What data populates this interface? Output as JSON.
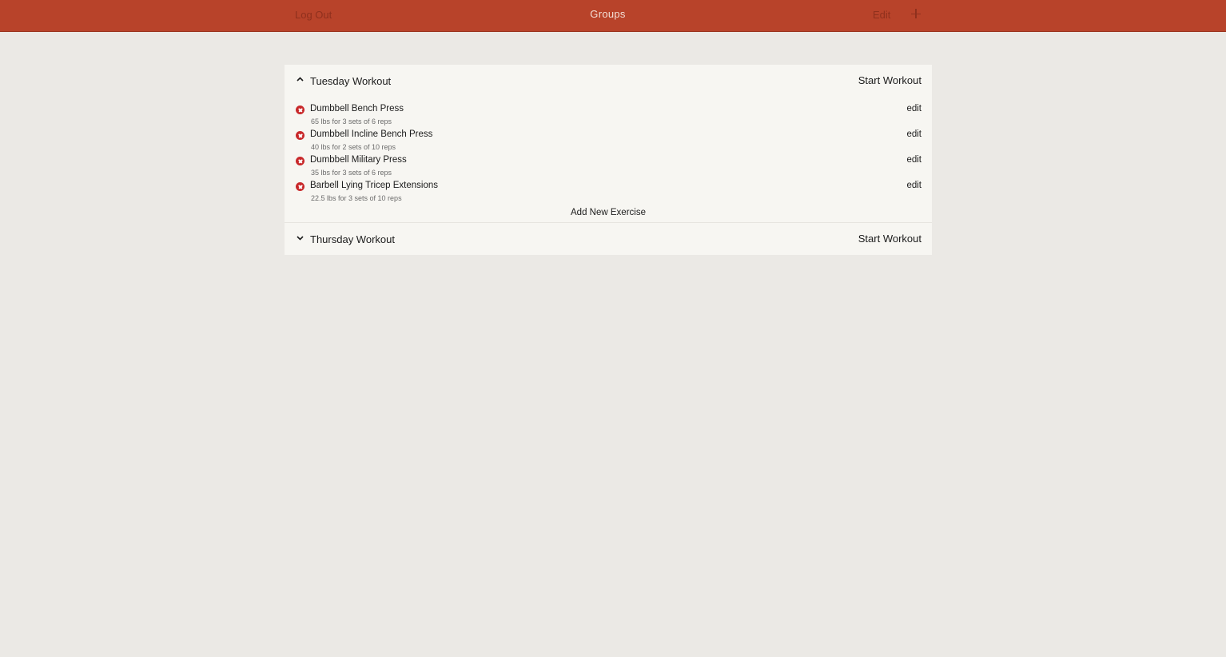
{
  "header": {
    "logout_label": "Log Out",
    "title": "Groups",
    "edit_label": "Edit",
    "add_icon": "plus-icon"
  },
  "groups": [
    {
      "name": "Tuesday Workout",
      "expanded": true,
      "chevron_icon": "chevron-up-icon",
      "start_label": "Start Workout",
      "exercises": [
        {
          "name": "Dumbbell Bench Press",
          "detail": "65 lbs for 3 sets of 6 reps",
          "edit_label": "edit"
        },
        {
          "name": "Dumbbell Incline Bench Press",
          "detail": "40 lbs for 2 sets of 10 reps",
          "edit_label": "edit"
        },
        {
          "name": "Dumbbell Military Press",
          "detail": "35 lbs for 3 sets of 6 reps",
          "edit_label": "edit"
        },
        {
          "name": "Barbell Lying Tricep Extensions",
          "detail": "22.5 lbs for 3 sets of 10 reps",
          "edit_label": "edit"
        }
      ],
      "add_exercise_label": "Add New Exercise"
    },
    {
      "name": "Thursday Workout",
      "expanded": false,
      "chevron_icon": "chevron-down-icon",
      "start_label": "Start Workout"
    }
  ],
  "colors": {
    "header_bg": "#b8432a",
    "page_bg": "#ebe9e5",
    "panel_bg": "#f7f6f2",
    "delete_icon": "#c8282a"
  }
}
